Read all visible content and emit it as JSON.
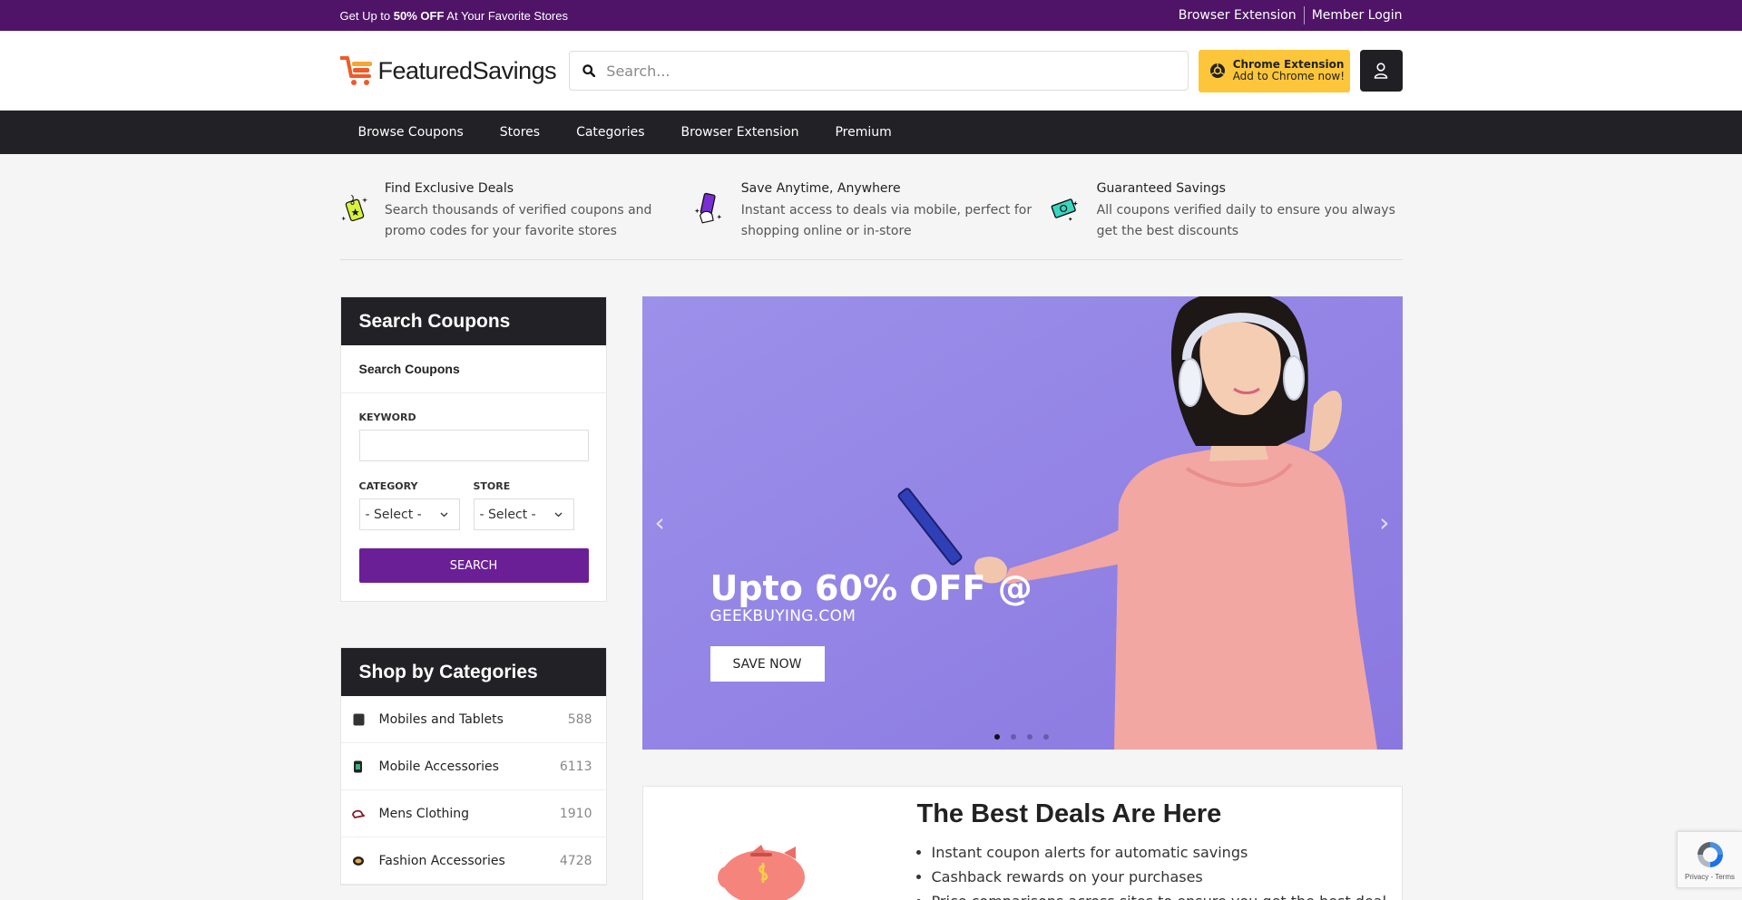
{
  "topbar": {
    "promo_prefix": "Get Up to",
    "promo_bold": "50% OFF",
    "promo_suffix": "At Your Favorite Stores",
    "link_extension": "Browser Extension",
    "link_login": "Member Login"
  },
  "header": {
    "logo_text": "FeaturedSavings",
    "search_placeholder": "Search...",
    "chrome_title": "Chrome Extension",
    "chrome_sub": "Add to Chrome now!"
  },
  "nav": {
    "items": [
      "Browse Coupons",
      "Stores",
      "Categories",
      "Browser Extension",
      "Premium"
    ]
  },
  "features": [
    {
      "title": "Find Exclusive Deals",
      "desc": "Search thousands of verified coupons and promo codes for your favorite stores"
    },
    {
      "title": "Save Anytime, Anywhere",
      "desc": "Instant access to deals via mobile, perfect for shopping online or in-store"
    },
    {
      "title": "Guaranteed Savings",
      "desc": "All coupons verified daily to ensure you always get the best discounts"
    }
  ],
  "search_box": {
    "title": "Search Coupons",
    "subtitle": "Search Coupons",
    "keyword_label": "KEYWORD",
    "category_label": "CATEGORY",
    "store_label": "STORE",
    "category_value": "- Select -",
    "store_value": "- Select -",
    "button": "SEARCH"
  },
  "categories": {
    "title": "Shop by Categories",
    "items": [
      {
        "name": "Mobiles and Tablets",
        "count": "588"
      },
      {
        "name": "Mobile Accessories",
        "count": "6113"
      },
      {
        "name": "Mens Clothing",
        "count": "1910"
      },
      {
        "name": "Fashion Accessories",
        "count": "4728"
      }
    ]
  },
  "hero": {
    "title": "Upto 60% OFF @",
    "subtitle": "GEEKBUYING.COM",
    "button": "SAVE NOW",
    "prev": "‹",
    "next": "›",
    "active_slide": 1,
    "slide_count": 4
  },
  "deals": {
    "title": "The Best Deals Are Here",
    "bullets": [
      "Instant coupon alerts for automatic savings",
      "Cashback rewards on your purchases",
      "Price comparisons across sites to ensure you get the best deal"
    ]
  },
  "recaptcha": {
    "text": "Privacy - Terms"
  },
  "colors": {
    "topbar": "#4f1468",
    "nav": "#222226",
    "accent": "#6b1f96",
    "chrome_button": "#fdc63a",
    "hero_bg": "#9487e6"
  }
}
